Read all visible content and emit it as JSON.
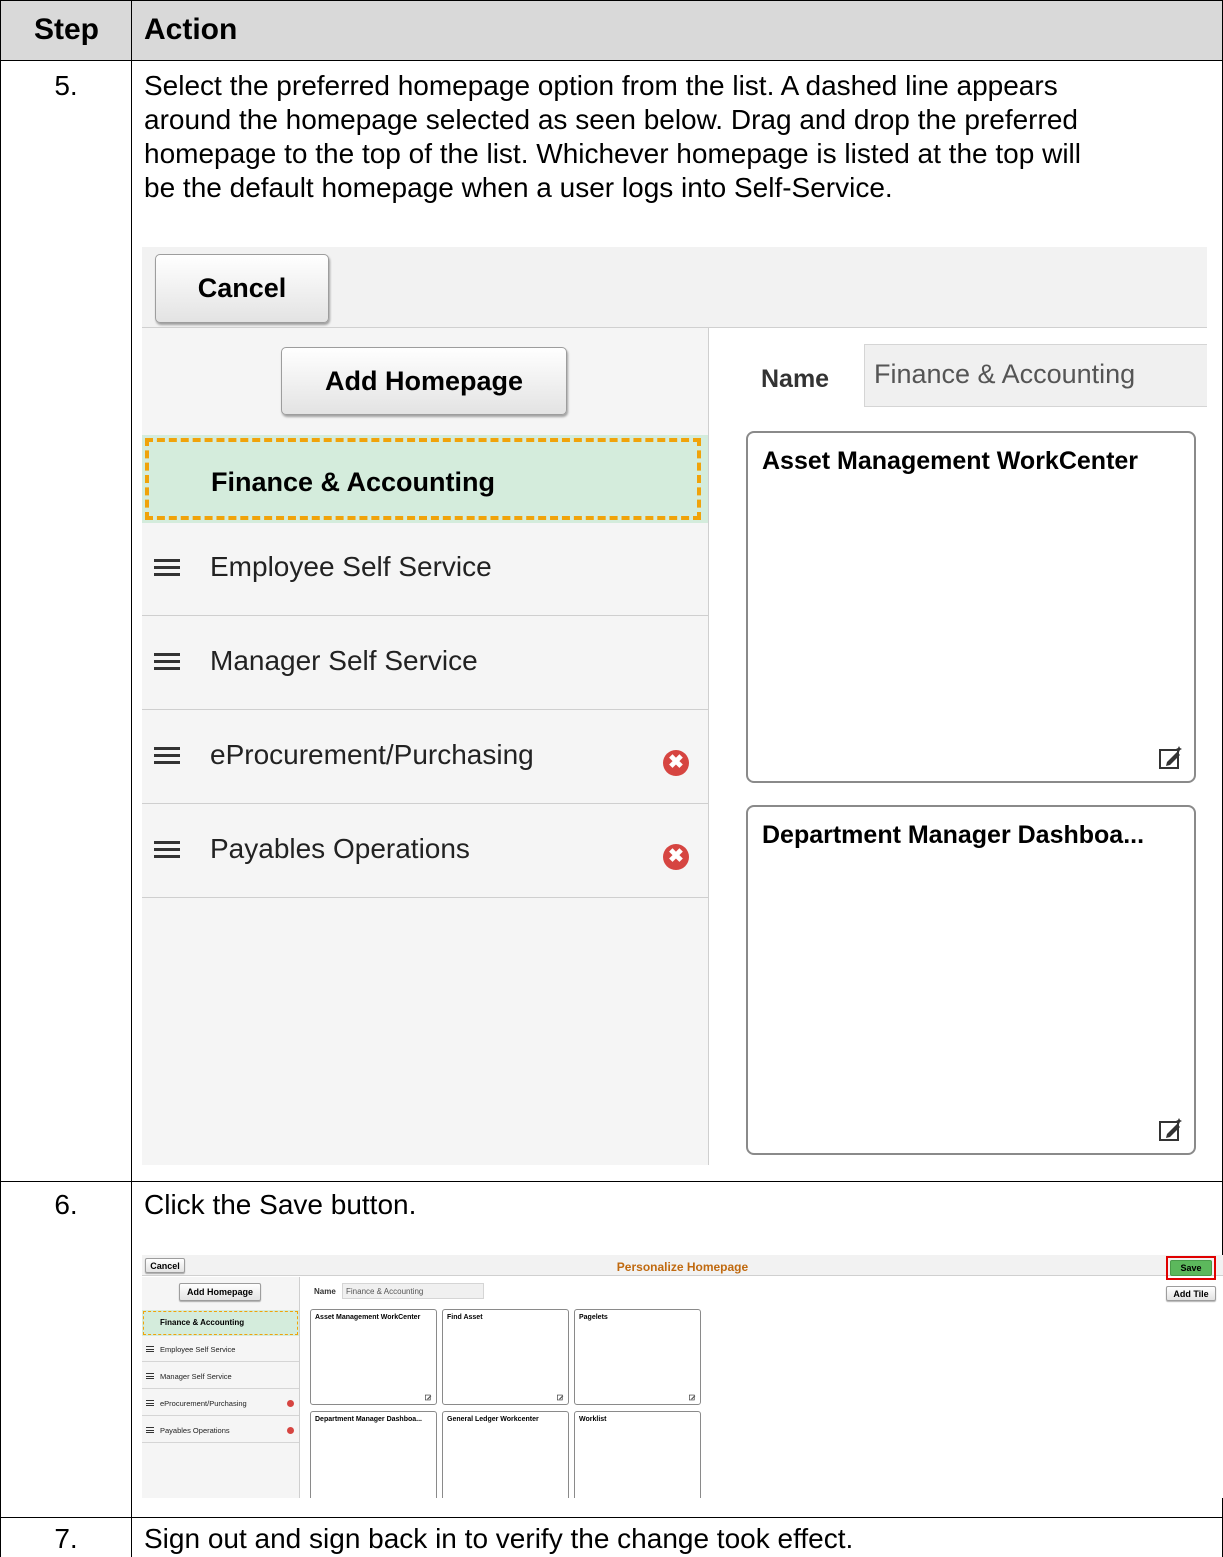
{
  "table": {
    "header": {
      "step": "Step",
      "action": "Action"
    },
    "steps": [
      {
        "num": "5.",
        "lines": [
          "Select the preferred homepage option from the list. A dashed line appears",
          "around the homepage selected as seen below. Drag and drop the preferred",
          "homepage to the top of the list. Whichever homepage is listed at the top will",
          "be the default homepage when a user logs into Self-Service."
        ]
      },
      {
        "num": "6.",
        "lines": [
          "Click the Save button."
        ]
      },
      {
        "num": "7.",
        "lines": [
          "Sign out and sign back in to verify the change took effect."
        ]
      }
    ]
  },
  "screenshot_large": {
    "cancel_label": "Cancel",
    "add_homepage_label": "Add Homepage",
    "selected_homepage": "Finance & Accounting",
    "homepages": [
      {
        "label": "Employee Self Service",
        "deletable": false
      },
      {
        "label": "Manager Self Service",
        "deletable": false
      },
      {
        "label": "eProcurement/Purchasing",
        "deletable": true
      },
      {
        "label": "Payables Operations",
        "deletable": true
      }
    ],
    "name_label": "Name",
    "name_value": "Finance & Accounting",
    "tiles": [
      "Asset Management WorkCenter",
      "Department Manager Dashboa..."
    ],
    "delete_glyph": "✖"
  },
  "screenshot_small": {
    "cancel_label": "Cancel",
    "page_title": "Personalize Homepage",
    "save_label": "Save",
    "add_homepage_label": "Add Homepage",
    "add_tile_label": "Add Tile",
    "selected_homepage": "Finance & Accounting",
    "homepages": [
      "Employee Self Service",
      "Manager Self Service",
      "eProcurement/Purchasing",
      "Payables Operations"
    ],
    "name_label": "Name",
    "name_value": "Finance & Accounting",
    "tiles_row1": [
      "Asset Management WorkCenter",
      "Find Asset",
      "Pagelets"
    ],
    "tiles_row2": [
      "Department Manager Dashboa...",
      "General Ledger Workcenter",
      "Worklist"
    ]
  },
  "colors": {
    "header_bg": "#d9d9d9",
    "selected_bg": "#d4ecdc",
    "dash_border": "#f0a30a",
    "delete_red": "#d64541",
    "save_green": "#5cb85c",
    "highlight_red": "#e00000",
    "title_orange": "#c06a10"
  }
}
